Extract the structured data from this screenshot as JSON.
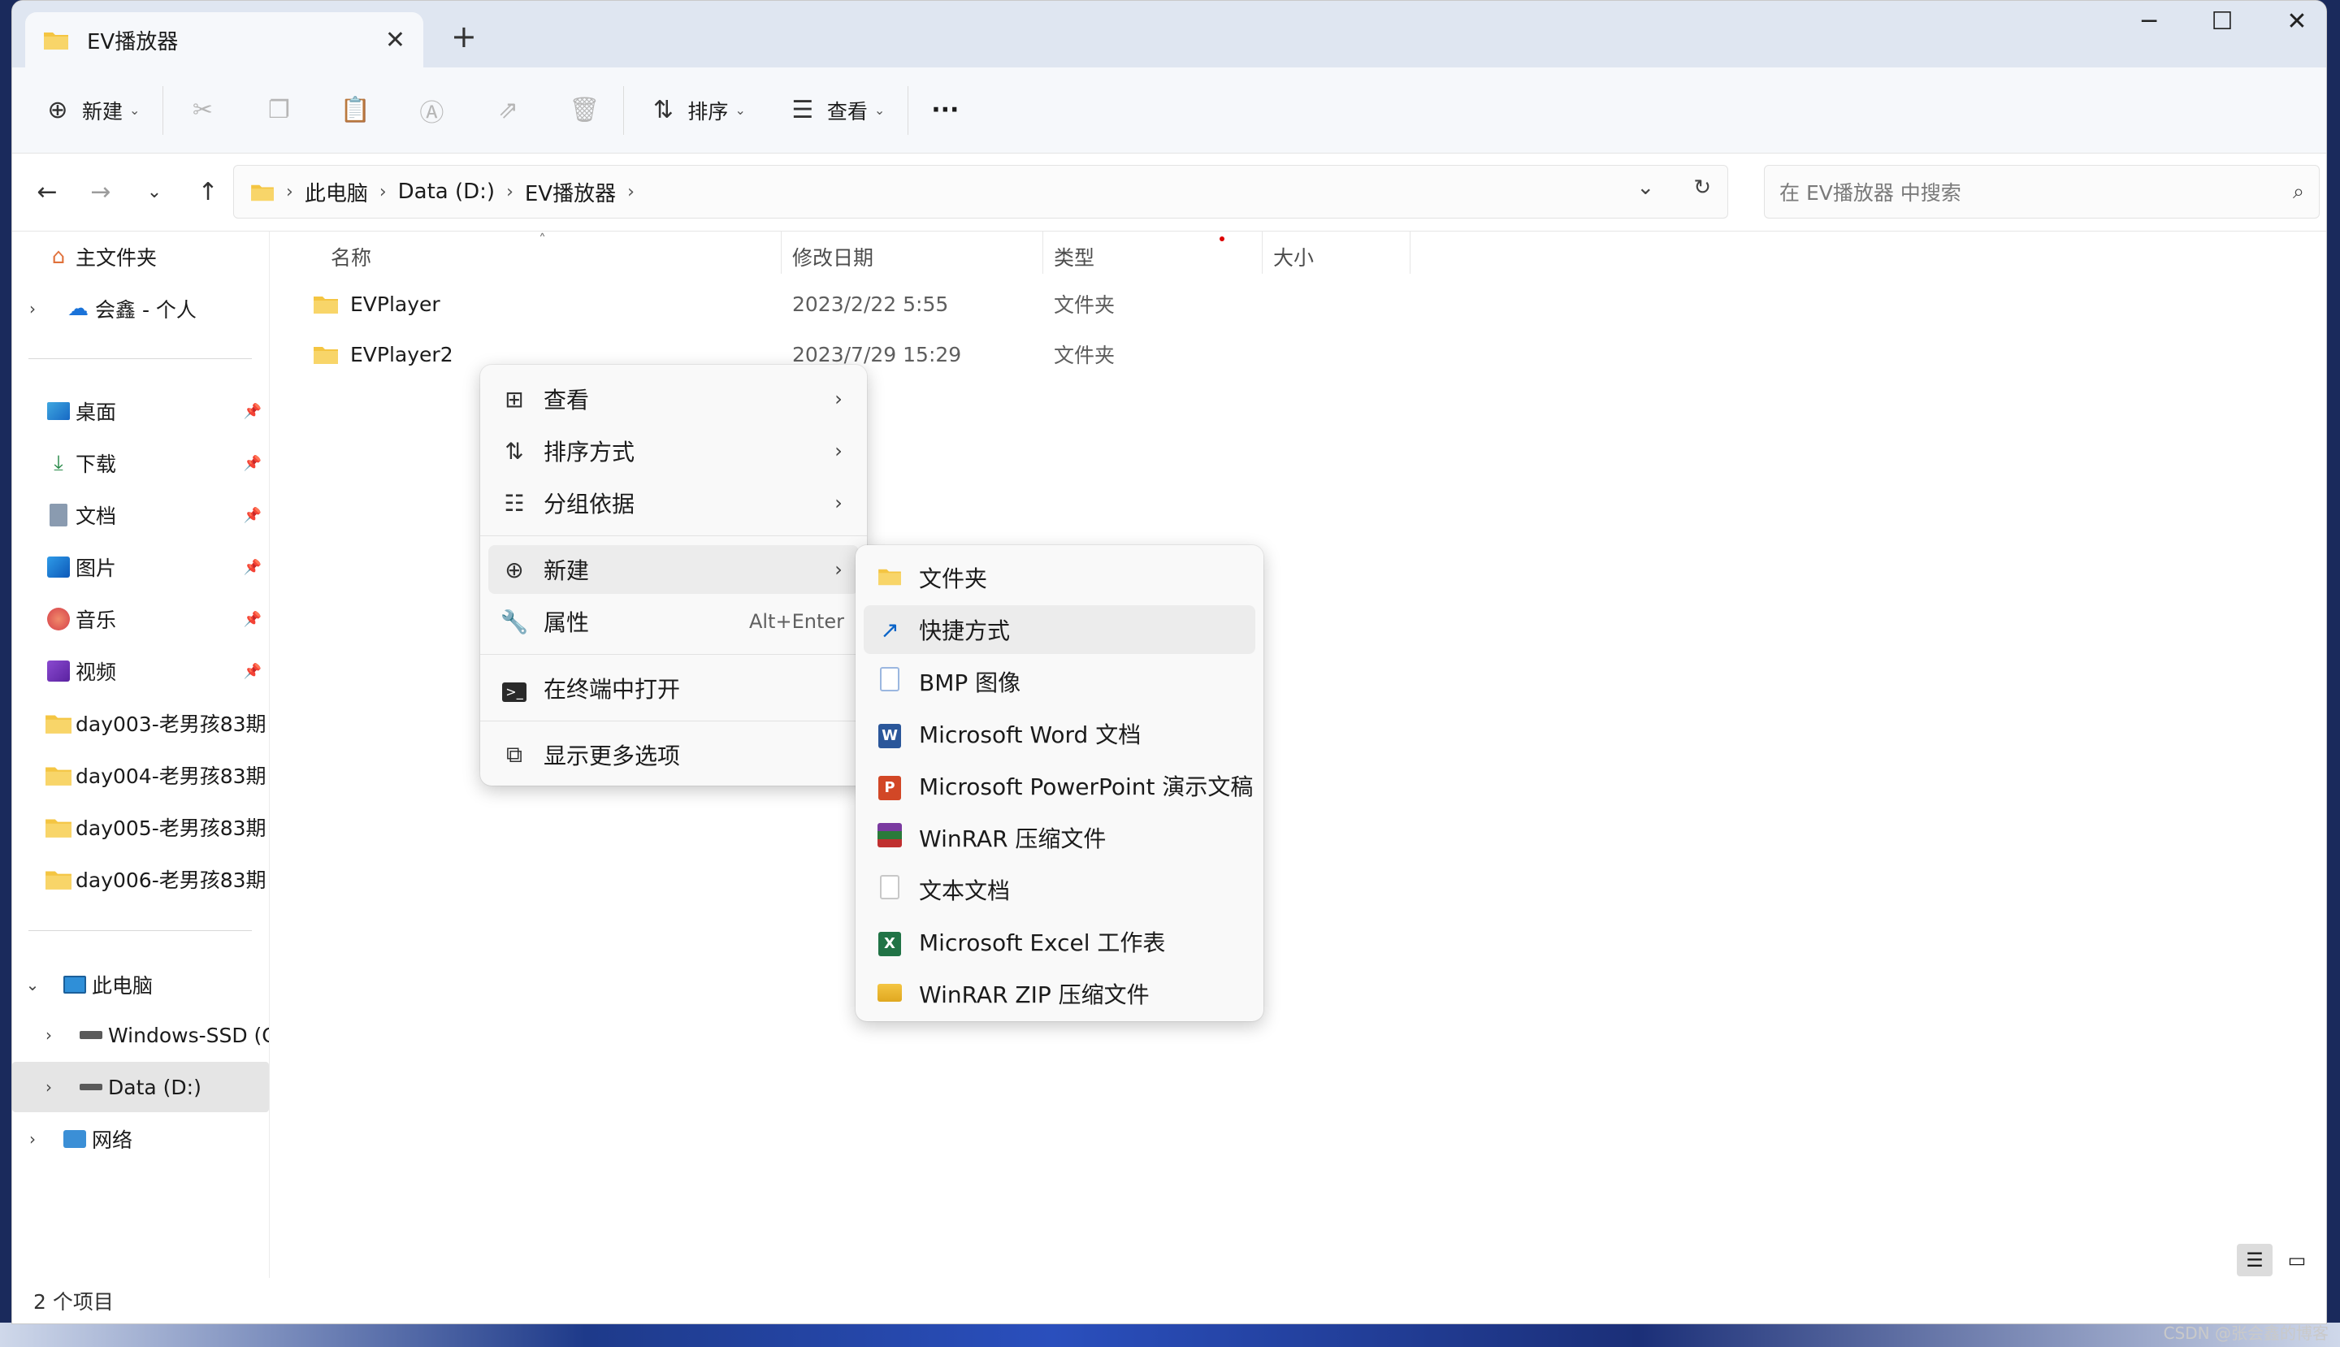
{
  "window": {
    "tab_title": "EV播放器",
    "controls": {
      "minimize": "─",
      "maximize": "☐",
      "close": "✕"
    }
  },
  "toolbar": {
    "new_label": "新建",
    "sort_label": "排序",
    "view_label": "查看",
    "more_label": "···"
  },
  "address": {
    "crumbs": [
      "此电脑",
      "Data (D:)",
      "EV播放器"
    ],
    "search_placeholder": "在 EV播放器 中搜索"
  },
  "sidebar": {
    "home": "主文件夹",
    "onedrive": "会鑫 - 个人",
    "quick": [
      {
        "label": "桌面",
        "icon": "desktop-icon"
      },
      {
        "label": "下载",
        "icon": "download-icon"
      },
      {
        "label": "文档",
        "icon": "document-icon"
      },
      {
        "label": "图片",
        "icon": "pictures-icon"
      },
      {
        "label": "音乐",
        "icon": "music-icon"
      },
      {
        "label": "视频",
        "icon": "video-icon"
      }
    ],
    "folders": [
      "day003-老男孩83期",
      "day004-老男孩83期",
      "day005-老男孩83期",
      "day006-老男孩83期"
    ],
    "this_pc": "此电脑",
    "drives": [
      "Windows-SSD (C:)",
      "Data (D:)"
    ],
    "network": "网络"
  },
  "columns": {
    "name": "名称",
    "modified": "修改日期",
    "type": "类型",
    "size": "大小"
  },
  "files": [
    {
      "name": "EVPlayer",
      "modified": "2023/2/22 5:55",
      "type": "文件夹"
    },
    {
      "name": "EVPlayer2",
      "modified": "2023/7/29 15:29",
      "type": "文件夹"
    }
  ],
  "context_menu": {
    "view": "查看",
    "sort_by": "排序方式",
    "group_by": "分组依据",
    "new": "新建",
    "properties": "属性",
    "properties_shortcut": "Alt+Enter",
    "open_terminal": "在终端中打开",
    "more_options": "显示更多选项"
  },
  "submenu": {
    "items": [
      "文件夹",
      "快捷方式",
      "BMP 图像",
      "Microsoft Word 文档",
      "Microsoft PowerPoint 演示文稿",
      "WinRAR 压缩文件",
      "文本文档",
      "Microsoft Excel 工作表",
      "WinRAR ZIP 压缩文件"
    ]
  },
  "status": {
    "item_count": "2 个项目"
  },
  "watermark": "CSDN @张会鑫的博客",
  "colors": {
    "accent": "#0a64c8",
    "folder": "#f4c542",
    "titlebar": "#dfe6f1"
  }
}
